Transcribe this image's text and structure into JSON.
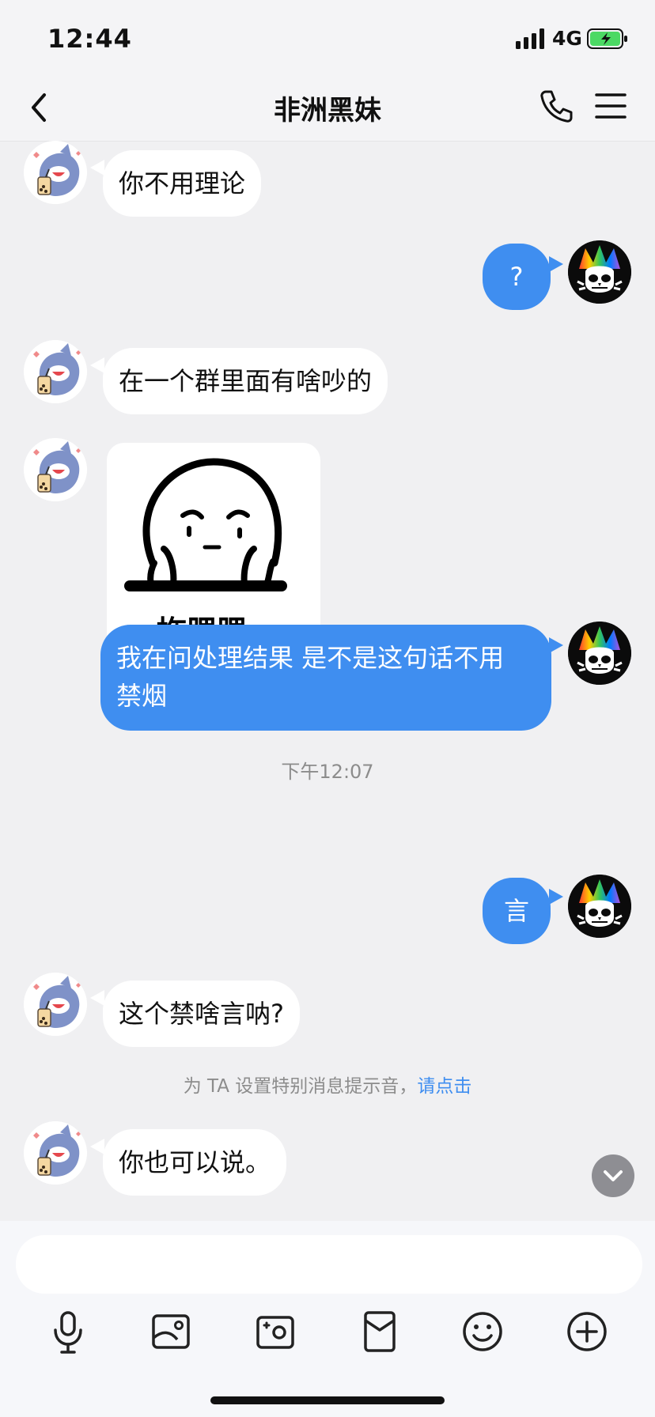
{
  "status_bar": {
    "time": "12:44",
    "network": "4G"
  },
  "header": {
    "title": "非洲黑妹"
  },
  "messages": [
    {
      "side": "in",
      "text": "你不用理论"
    },
    {
      "side": "out",
      "text": "?"
    },
    {
      "side": "in",
      "text": "在一个群里面有啥吵的"
    },
    {
      "side": "in",
      "sticker_text": "拖腮腮"
    },
    {
      "side": "out",
      "text": "我在问处理结果 是不是这句话不用\n禁烟"
    },
    {
      "side": "out",
      "text": "言"
    },
    {
      "side": "in",
      "text": "这个禁啥言呐?"
    },
    {
      "side": "in",
      "text": "你也可以说。"
    }
  ],
  "timestamp": "下午12:07",
  "notice": {
    "text": "为 TA 设置特别消息提示音，",
    "link": "请点击"
  },
  "input": {
    "placeholder": ""
  },
  "toolbar": {
    "icons": [
      "microphone-icon",
      "image-icon",
      "camera-icon",
      "red-packet-icon",
      "emoji-icon",
      "plus-icon"
    ]
  },
  "colors": {
    "outgoing_bubble": "#3f8ef0",
    "incoming_bubble": "#ffffff",
    "background": "#f0f0f2",
    "link": "#3f8ef0"
  }
}
